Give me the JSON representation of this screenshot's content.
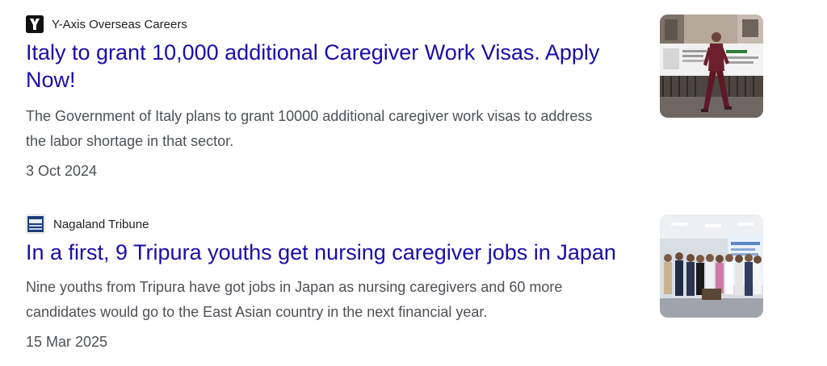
{
  "articles": [
    {
      "source": "Y-Axis Overseas Careers",
      "source_icon": "y-axis-logo-icon",
      "title": "Italy to grant 10,000 additional Caregiver Work Visas. Apply Now!",
      "snippet": "The Government of Italy plans to grant 10000 additional caregiver work visas to address the labor shortage in that sector.",
      "date": "3 Oct 2024",
      "thumbnail": "woman-walking-past-poster-image"
    },
    {
      "source": "Nagaland Tribune",
      "source_icon": "nagaland-tribune-logo-icon",
      "title": "In a first, 9 Tripura youths get nursing caregiver jobs in Japan",
      "snippet": "Nine youths from Tripura have got jobs in Japan as nursing caregivers and 60 more candidates would go to the East Asian country in the next financial year.",
      "date": "15 Mar 2025",
      "thumbnail": "group-photo-image"
    }
  ],
  "colors": {
    "link": "#1a0dab",
    "snippet": "#4d5156",
    "source": "#202124"
  }
}
